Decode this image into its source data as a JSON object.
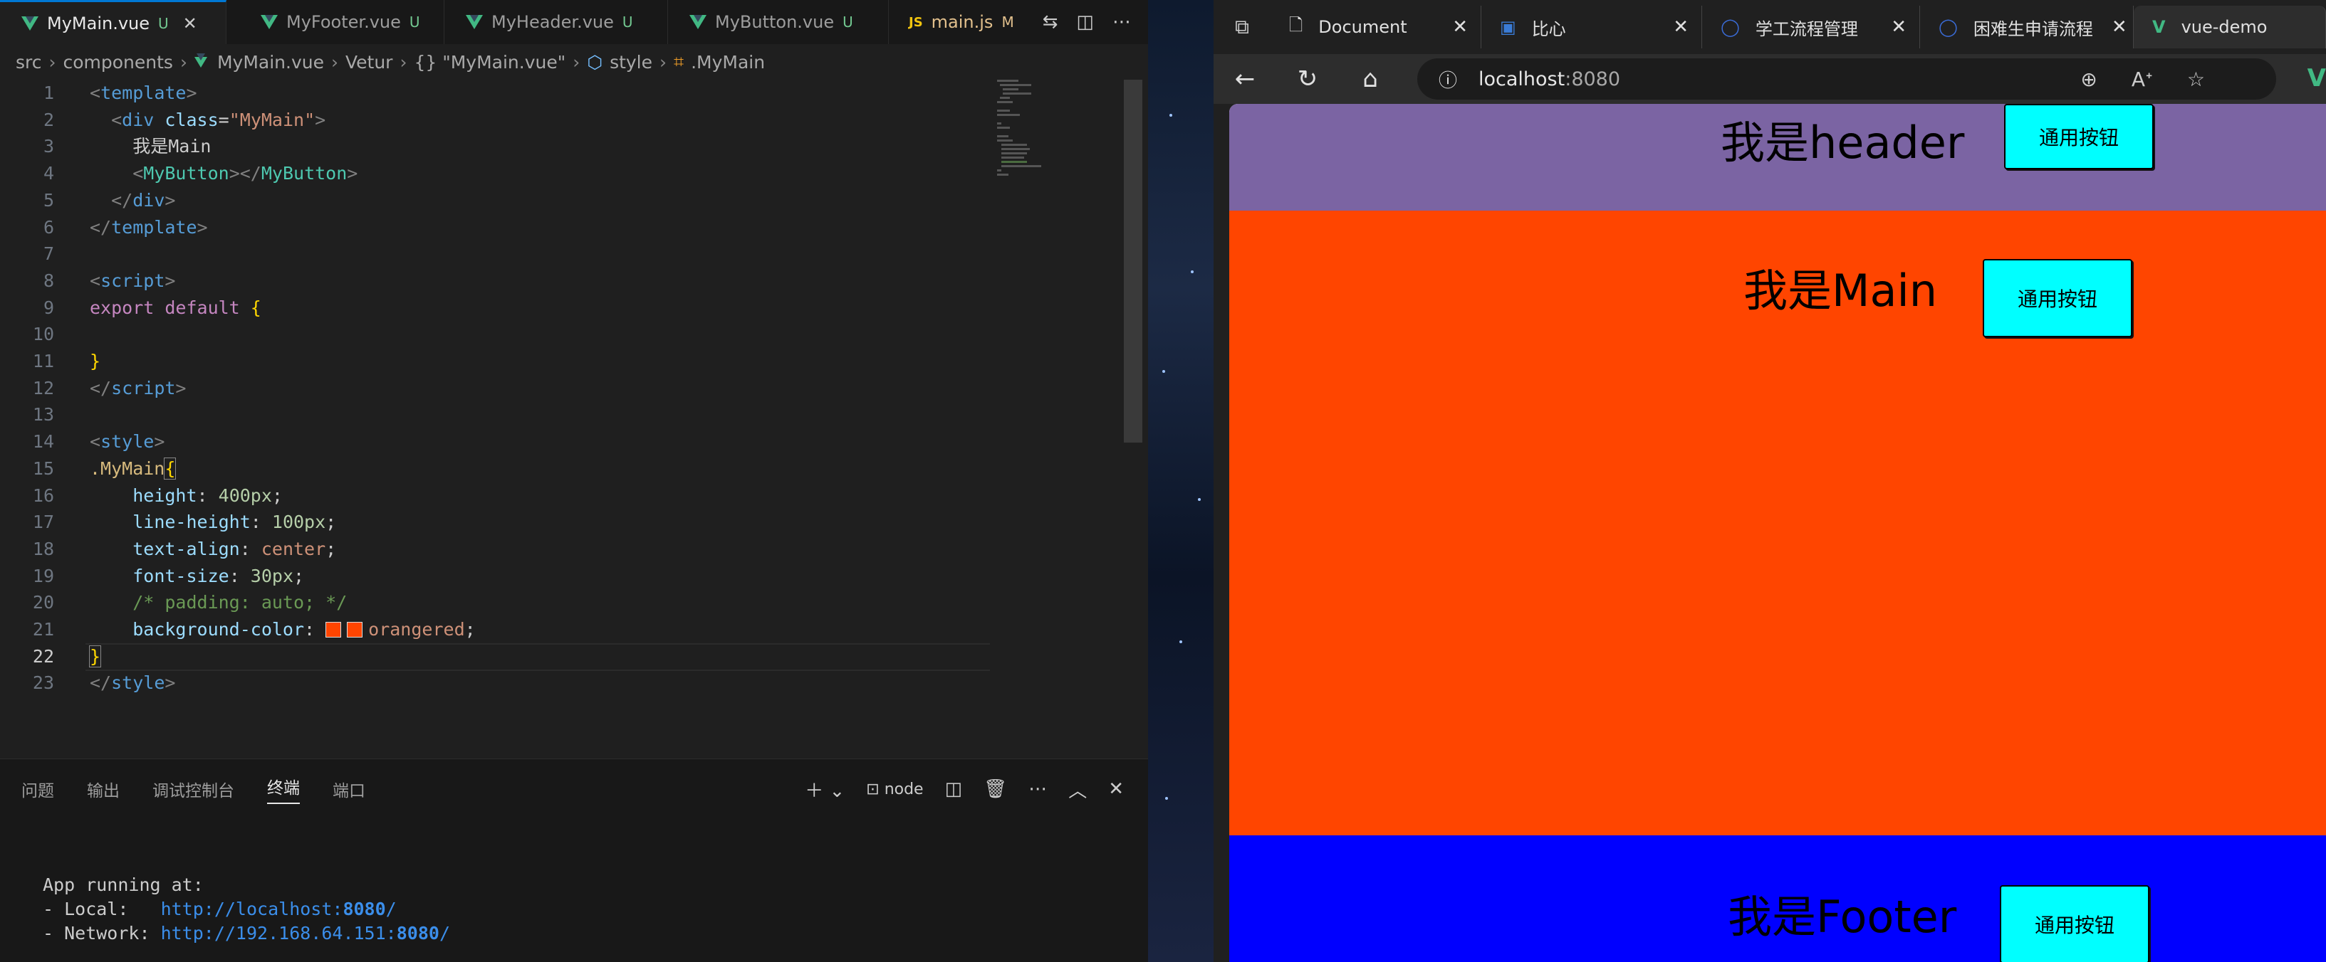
{
  "editor_tabs": [
    {
      "label": "MyMain.vue",
      "badge": "U",
      "type": "vue"
    },
    {
      "label": "MyFooter.vue",
      "badge": "U",
      "type": "vue"
    },
    {
      "label": "MyHeader.vue",
      "badge": "U",
      "type": "vue"
    },
    {
      "label": "MyButton.vue",
      "badge": "U",
      "type": "vue"
    },
    {
      "label": "main.js",
      "badge": "M",
      "type": "js"
    }
  ],
  "breadcrumb": [
    "src",
    "components",
    "MyMain.vue",
    "Vetur",
    "{} \"MyMain.vue\"",
    "style",
    ".MyMain"
  ],
  "code_lines": [
    {
      "n": "1"
    },
    {
      "n": "2"
    },
    {
      "n": "3"
    },
    {
      "n": "4"
    },
    {
      "n": "5"
    },
    {
      "n": "6"
    },
    {
      "n": "7"
    },
    {
      "n": "8"
    },
    {
      "n": "9"
    },
    {
      "n": "10"
    },
    {
      "n": "11"
    },
    {
      "n": "12"
    },
    {
      "n": "13"
    },
    {
      "n": "14"
    },
    {
      "n": "15"
    },
    {
      "n": "16"
    },
    {
      "n": "17"
    },
    {
      "n": "18"
    },
    {
      "n": "19"
    },
    {
      "n": "20"
    },
    {
      "n": "21"
    },
    {
      "n": "22"
    },
    {
      "n": "23"
    }
  ],
  "code": {
    "l1": "<template>",
    "l2_tag": "div",
    "l2_attr": "class",
    "l2_val": "\"MyMain\"",
    "l3": "我是Main",
    "l4_comp": "MyButton",
    "l5_tag": "div",
    "l6_tag": "template",
    "l8_tag": "script",
    "l9_kw1": "export",
    "l9_kw2": "default",
    "l9_brace": "{",
    "l11_brace": "}",
    "l12_tag": "script",
    "l14_tag": "style",
    "l15_sel": ".MyMain",
    "l15_brace": "{",
    "l16_prop": "height",
    "l16_val": "400px",
    "l17_prop": "line-height",
    "l17_val": "100px",
    "l18_prop": "text-align",
    "l18_val": "center",
    "l19_prop": "font-size",
    "l19_val": "30px",
    "l20_comment": "/* padding: auto; */",
    "l21_prop": "background-color",
    "l21_val": "orangered",
    "l22_brace": "}",
    "l23_tag": "style"
  },
  "panel": {
    "tabs": [
      "问题",
      "输出",
      "调试控制台",
      "终端",
      "端口"
    ],
    "active_tab": "终端",
    "shell": "node"
  },
  "terminal": {
    "line1": "App running at:",
    "local_label": "- Local:   ",
    "local_url_prefix": "http://localhost:",
    "local_port": "8080",
    "network_label": "- Network: ",
    "network_url_prefix": "http://192.168.64.151:",
    "network_port": "8080",
    "trailing_slash": "/"
  },
  "browser": {
    "tabs": [
      {
        "label": "Document"
      },
      {
        "label": "比心"
      },
      {
        "label": "学工流程管理"
      },
      {
        "label": "困难生申请流程"
      },
      {
        "label": "vue-demo"
      }
    ],
    "url_host": "localhost",
    "url_port": ":8080"
  },
  "page": {
    "header_text": "我是header",
    "main_text": "我是Main",
    "footer_text": "我是Footer",
    "button_label": "通用按钮",
    "colors": {
      "header": "#7b64a3",
      "main": "#ff4500",
      "footer": "#0000ff",
      "button": "#00ffff"
    }
  }
}
